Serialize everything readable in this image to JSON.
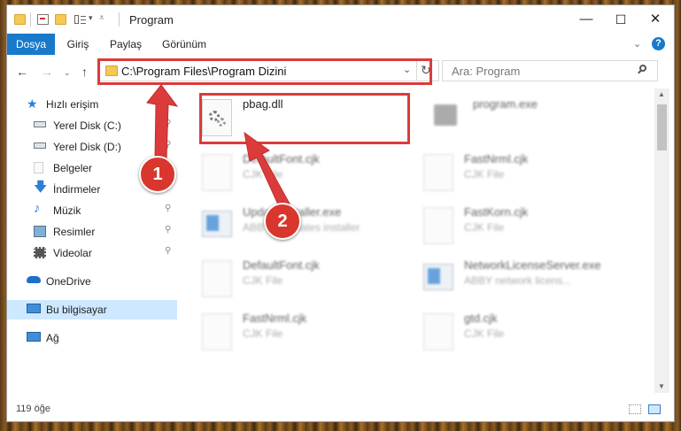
{
  "window": {
    "title": "Program",
    "controls": {
      "minimize": "—",
      "maximize": "☐",
      "close": "✕"
    }
  },
  "ribbon": {
    "tabs": [
      "Dosya",
      "Giriş",
      "Paylaş",
      "Görünüm"
    ],
    "help": "?"
  },
  "address": {
    "path": "C:\\Program Files\\Program Dizini",
    "search_placeholder": "Ara: Program"
  },
  "sidebar": {
    "items": [
      {
        "label": "Hızlı erişim",
        "icon": "star-icon"
      },
      {
        "label": "Yerel Disk (C:)",
        "icon": "drive-icon",
        "pinned": true
      },
      {
        "label": "Yerel Disk (D:)",
        "icon": "drive-icon",
        "pinned": true
      },
      {
        "label": "Belgeler",
        "icon": "documents-icon",
        "pinned": true
      },
      {
        "label": "İndirmeler",
        "icon": "download-icon",
        "pinned": true
      },
      {
        "label": "Müzik",
        "icon": "music-icon",
        "pinned": true
      },
      {
        "label": "Resimler",
        "icon": "pictures-icon",
        "pinned": true
      },
      {
        "label": "Videolar",
        "icon": "videos-icon",
        "pinned": true
      },
      {
        "label": "OneDrive",
        "icon": "cloud-icon"
      },
      {
        "label": "Bu bilgisayar",
        "icon": "computer-icon",
        "selected": true
      },
      {
        "label": "Ağ",
        "icon": "network-icon"
      }
    ]
  },
  "files": [
    {
      "name": "pbag.dll",
      "type": "",
      "icon": "dll-gear-icon"
    },
    {
      "name": "program.exe",
      "type": "",
      "icon": "exe-icon"
    },
    {
      "name": "DefaultFont.cjk",
      "type": "CJK File",
      "icon": "file-icon"
    },
    {
      "name": "FastNrml.cjk",
      "type": "CJK File",
      "icon": "file-icon"
    },
    {
      "name": "UpdateInstaller.exe",
      "type": "ABBYY Updates installer",
      "icon": "installer-icon"
    },
    {
      "name": "FastKorn.cjk",
      "type": "CJK File",
      "icon": "file-icon"
    },
    {
      "name": "DefaultFont.cjk",
      "type": "CJK File",
      "icon": "file-icon"
    },
    {
      "name": "NetworkLicenseServer.exe",
      "type": "ABBY network licens...",
      "icon": "installer-icon"
    },
    {
      "name": "FastNrml.cjk",
      "type": "CJK File",
      "icon": "file-icon"
    },
    {
      "name": "gtd.cjk",
      "type": "CJK File",
      "icon": "file-icon"
    }
  ],
  "status": {
    "item_count": "119 öğe"
  },
  "annotations": {
    "badge1": "1",
    "badge2": "2"
  },
  "colors": {
    "accent": "#1979ca",
    "highlight": "#dc3b3b",
    "selected": "#cde8ff",
    "folder": "#f6c854"
  }
}
